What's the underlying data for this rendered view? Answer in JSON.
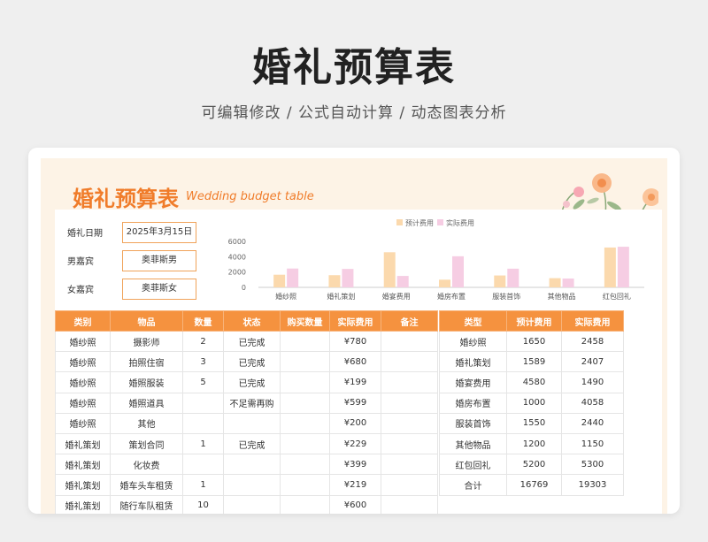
{
  "hero": {
    "title": "婚礼预算表",
    "subtitle": "可编辑修改 /  公式自动计算  /  动态图表分析"
  },
  "sheet": {
    "title": "婚礼预算表",
    "subtitle": "Wedding budget table"
  },
  "info": [
    {
      "label": "婚礼日期",
      "value": "2025年3月15日"
    },
    {
      "label": "男嘉宾",
      "value": "奥菲斯男"
    },
    {
      "label": "女嘉宾",
      "value": "奥菲斯女"
    }
  ],
  "colors": {
    "accent": "#f5923f",
    "title": "#f07c2a",
    "budget_bar": "#fbd9ad",
    "actual_bar": "#f6cde3"
  },
  "main_table": {
    "headers": [
      "类别",
      "物品",
      "数量",
      "状态",
      "购买数量",
      "实际费用",
      "备注"
    ],
    "rows": [
      [
        "婚纱照",
        "摄影师",
        "2",
        "已完成",
        "",
        "¥780",
        ""
      ],
      [
        "婚纱照",
        "拍照住宿",
        "3",
        "已完成",
        "",
        "¥680",
        ""
      ],
      [
        "婚纱照",
        "婚照服装",
        "5",
        "已完成",
        "",
        "¥199",
        ""
      ],
      [
        "婚纱照",
        "婚照道具",
        "",
        "不足需再购",
        "",
        "¥599",
        ""
      ],
      [
        "婚纱照",
        "其他",
        "",
        "",
        "",
        "¥200",
        ""
      ],
      [
        "婚礼策划",
        "策划合同",
        "1",
        "已完成",
        "",
        "¥229",
        ""
      ],
      [
        "婚礼策划",
        "化妆费",
        "",
        "",
        "",
        "¥399",
        ""
      ],
      [
        "婚礼策划",
        "婚车头车租赁",
        "1",
        "",
        "",
        "¥219",
        ""
      ],
      [
        "婚礼策划",
        "随行车队租赁",
        "10",
        "",
        "",
        "¥600",
        ""
      ]
    ]
  },
  "side_table": {
    "headers": [
      "类型",
      "预计费用",
      "实际费用"
    ],
    "rows": [
      [
        "婚纱照",
        "1650",
        "2458"
      ],
      [
        "婚礼策划",
        "1589",
        "2407"
      ],
      [
        "婚宴费用",
        "4580",
        "1490"
      ],
      [
        "婚房布置",
        "1000",
        "4058"
      ],
      [
        "服装首饰",
        "1550",
        "2440"
      ],
      [
        "其他物品",
        "1200",
        "1150"
      ],
      [
        "红包回礼",
        "5200",
        "5300"
      ],
      [
        "合计",
        "16769",
        "19303"
      ]
    ]
  },
  "chart_data": {
    "type": "bar",
    "categories": [
      "婚纱照",
      "婚礼策划",
      "婚宴费用",
      "婚房布置",
      "服装首饰",
      "其他物品",
      "红包回礼"
    ],
    "series": [
      {
        "name": "预计费用",
        "values": [
          1650,
          1589,
          4580,
          1000,
          1550,
          1200,
          5200
        ]
      },
      {
        "name": "实际费用",
        "values": [
          2458,
          2407,
          1490,
          4058,
          2440,
          1150,
          5300
        ]
      }
    ],
    "yticks": [
      "6000",
      "4000",
      "2000",
      "0"
    ],
    "ylim": [
      0,
      6000
    ],
    "legend": "top",
    "grid": false
  }
}
